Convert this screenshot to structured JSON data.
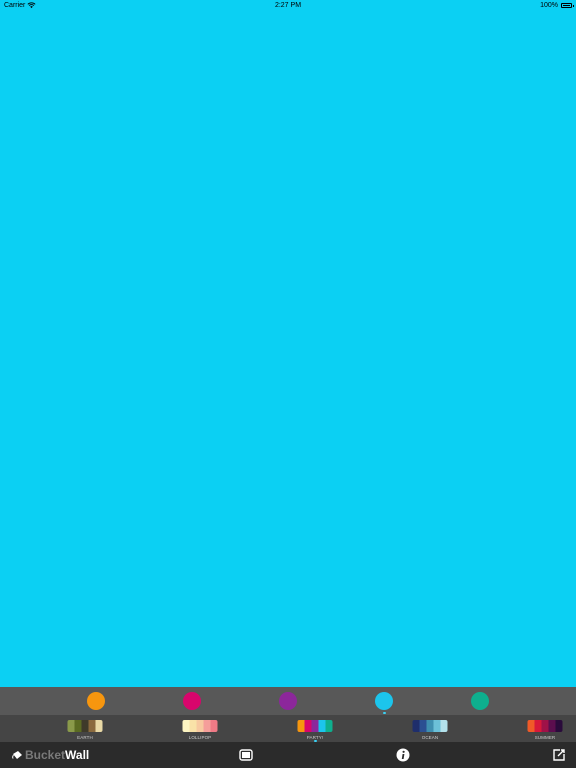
{
  "wallpaper": {
    "color": "#0bd0f3"
  },
  "status_bar": {
    "carrier": "Carrier",
    "time": "2:27 PM",
    "battery": "100%"
  },
  "colors": {
    "selected_index": 3,
    "items": [
      {
        "name": "orange",
        "hex": "#f7960e"
      },
      {
        "name": "magenta",
        "hex": "#d8056c"
      },
      {
        "name": "purple",
        "hex": "#8c279b"
      },
      {
        "name": "sky-blue",
        "hex": "#1cc5ec"
      },
      {
        "name": "teal",
        "hex": "#0eaf8e"
      }
    ]
  },
  "palettes": {
    "selected_index": 2,
    "items": [
      {
        "label": "EARTH",
        "colors": [
          "#8a9a4a",
          "#5b6b22",
          "#3e3a2a",
          "#8b6a3e",
          "#e9d9a6"
        ]
      },
      {
        "label": "LOLLIPOP",
        "colors": [
          "#fdf5c2",
          "#f9e2a8",
          "#f7c9a0",
          "#f59e9a",
          "#ef7a86"
        ]
      },
      {
        "label": "PARTY!",
        "colors": [
          "#f7960e",
          "#d8056c",
          "#8c279b",
          "#1cc5ec",
          "#0eaf8e"
        ]
      },
      {
        "label": "OCEAN",
        "colors": [
          "#1f2e6b",
          "#2b4f92",
          "#3f8fb0",
          "#6cc0d8",
          "#b4e2ec"
        ]
      },
      {
        "label": "SUMMER",
        "colors": [
          "#f05a28",
          "#d8183a",
          "#a01248",
          "#5c0e4e",
          "#2a0b3b"
        ]
      }
    ]
  },
  "toolbar": {
    "logo_part1": "Bucket",
    "logo_part2": "Wall",
    "colors": {
      "icon": "#ffffff"
    }
  }
}
